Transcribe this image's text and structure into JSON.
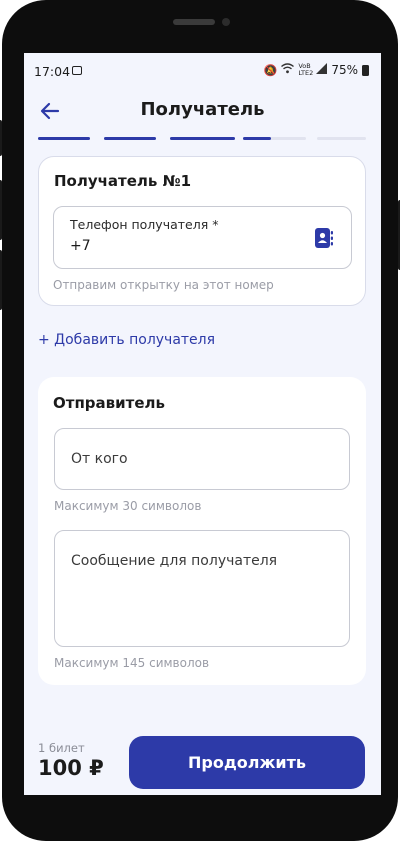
{
  "status_bar": {
    "time": "17:04",
    "network_label": "VoB LTE2",
    "battery": "75%"
  },
  "header": {
    "title": "Получатель"
  },
  "progress": {
    "steps": [
      1,
      1,
      1,
      0.45,
      0
    ]
  },
  "recipient": {
    "title": "Получатель №1",
    "phone_label": "Телефон получателя *",
    "phone_value": "+7",
    "helper": "Отправим открытку на этот номер"
  },
  "add_recipient": "+ Добавить получателя",
  "sender": {
    "title": "Отправитель",
    "from_placeholder": "От кого",
    "from_helper": "Максимум 30 символов",
    "message_placeholder": "Сообщение для получателя",
    "message_helper": "Максимум 145 символов"
  },
  "footer": {
    "tickets": "1 билет",
    "price": "100 ₽",
    "continue_label": "Продолжить"
  },
  "colors": {
    "accent": "#2d3aa8",
    "background": "#f3f5fd"
  }
}
